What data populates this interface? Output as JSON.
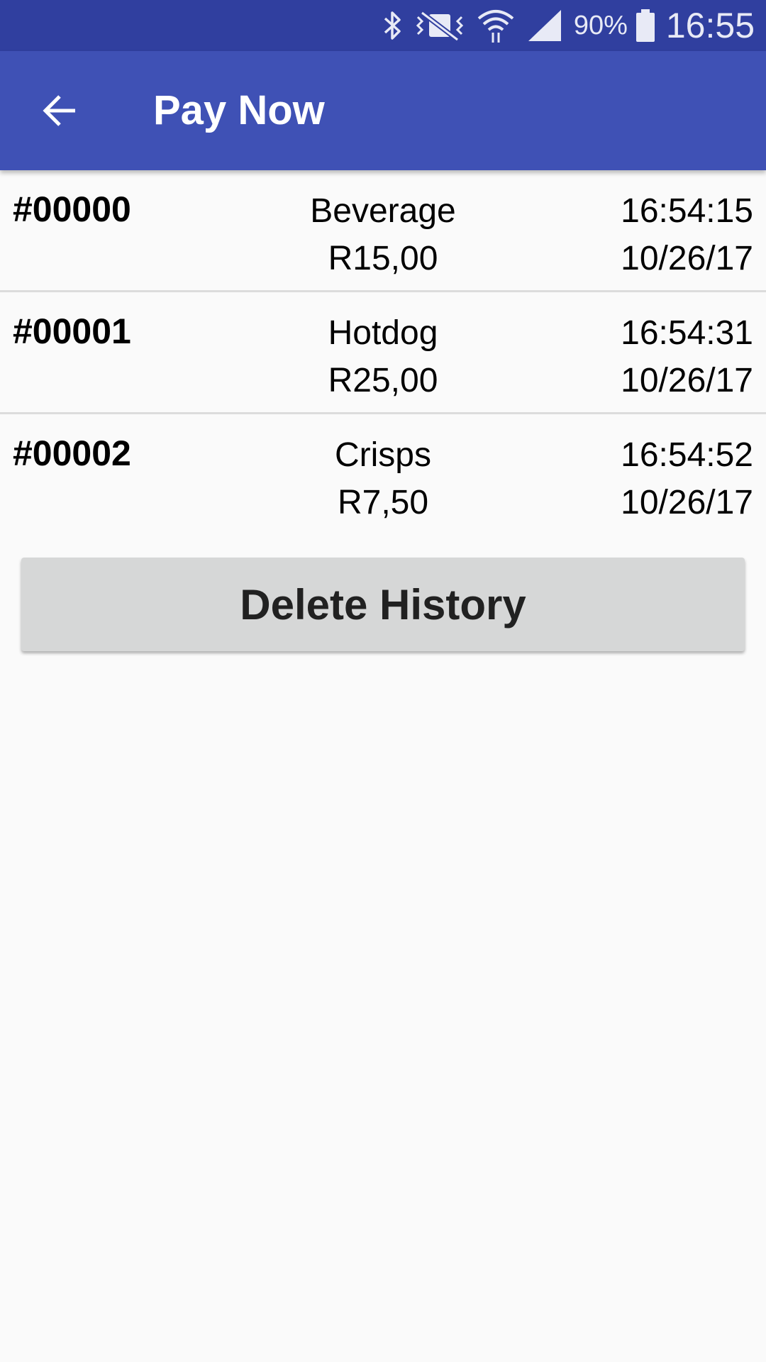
{
  "status_bar": {
    "battery": "90%",
    "time": "16:55",
    "icons": [
      "bluetooth-icon",
      "vibrate-icon",
      "wifi-icon",
      "signal-icon",
      "battery-icon"
    ]
  },
  "app_bar": {
    "title": "Pay Now",
    "back_icon": "arrow-back-icon"
  },
  "orders": [
    {
      "id": "#00000",
      "item": "Beverage",
      "price": "R15,00",
      "time": "16:54:15",
      "date": "10/26/17"
    },
    {
      "id": "#00001",
      "item": "Hotdog",
      "price": "R25,00",
      "time": "16:54:31",
      "date": "10/26/17"
    },
    {
      "id": "#00002",
      "item": "Crisps",
      "price": "R7,50",
      "time": "16:54:52",
      "date": "10/26/17"
    }
  ],
  "actions": {
    "delete_label": "Delete History"
  },
  "colors": {
    "status_bar": "#303f9f",
    "app_bar": "#3f51b5",
    "background": "#fafafa",
    "button": "#d6d7d7"
  }
}
